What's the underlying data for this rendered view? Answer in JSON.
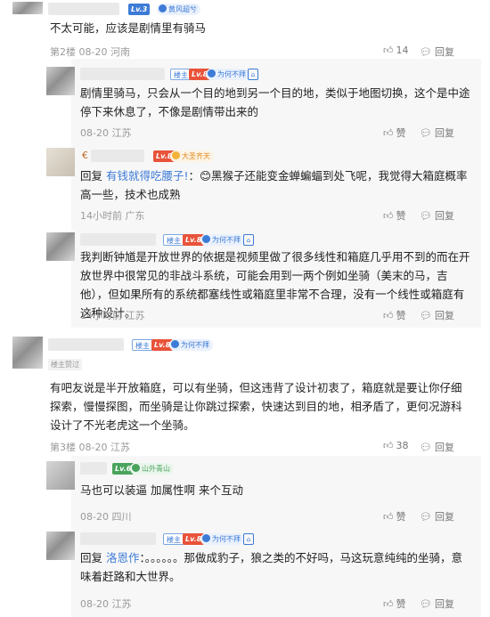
{
  "c1": {
    "level": "Lv.3",
    "medal": "黄风超兮",
    "text": "不太可能，应该是剧情里有骑马",
    "meta": "第2楼 08-20 河南",
    "like_count": "14",
    "reply_label": "回复"
  },
  "r1": {
    "op_badge": "楼主",
    "level": "Lv.8",
    "medal": "为何不拜",
    "text": "剧情里骑马，只会从一个目的地到另一个目的地，类似于地图切换，这个是中途停下来休息了，不像是剧情带出来的",
    "meta": "08-20 江苏",
    "like_label": "赞",
    "reply_label": "回复"
  },
  "r2": {
    "name_prefix": "€",
    "level": "Lv.8",
    "medal": "大圣齐天",
    "reply_prefix": "回复",
    "reply_to": "有钱就得吃腰子!",
    "text_after": "：😊黑猴子还能变金蝉蝙蝠到处飞呢，我觉得大箱庭概率高一些，技术也成熟",
    "meta": "14小时前 广东",
    "like_label": "赞",
    "reply_label": "回复"
  },
  "r3": {
    "op_badge": "楼主",
    "level": "Lv.8",
    "medal": "为何不拜",
    "text": "我判断钟馗是开放世界的依据是视频里做了很多线性和箱庭几乎用不到的而在开放世界中很常见的非战斗系统，可能会用到一两个例如坐骑（美末的马，吉他），但如果所有的系统都塞线性或箱庭里非常不合理，没有一个线性或箱庭有这种设计。",
    "meta": "14小时前 江苏",
    "like_label": "赞",
    "reply_label": "回复"
  },
  "c2": {
    "op_badge": "楼主",
    "level": "Lv.8",
    "medal": "为何不拜",
    "author_note": "楼主赞过",
    "text": "有吧友说是半开放箱庭，可以有坐骑，但这违背了设计初衷了，箱庭就是要让你仔细探索，慢慢探图，而坐骑是让你跳过探索，快速达到目的地，相矛盾了，更何况游科设计了不光老虎这一个坐骑。",
    "meta": "第3楼 08-20 江苏",
    "like_count": "38",
    "reply_label": "回复"
  },
  "r4": {
    "level": "Lv.6",
    "medal": "山外青山",
    "text": "马也可以装逼 加属性啊 来个互动",
    "meta": "08-20 四川",
    "like_label": "赞",
    "reply_label": "回复"
  },
  "r5": {
    "op_badge": "楼主",
    "level": "Lv.8",
    "medal": "为何不拜",
    "reply_prefix": "回复",
    "reply_to": "洛恩作",
    "text_after": "：。。。。。。那做成豹子，狼之类的不好吗，马这玩意纯纯的坐骑，意味着赶路和大世界。",
    "meta": "08-20 江苏",
    "like_label": "赞",
    "reply_label": "回复"
  }
}
